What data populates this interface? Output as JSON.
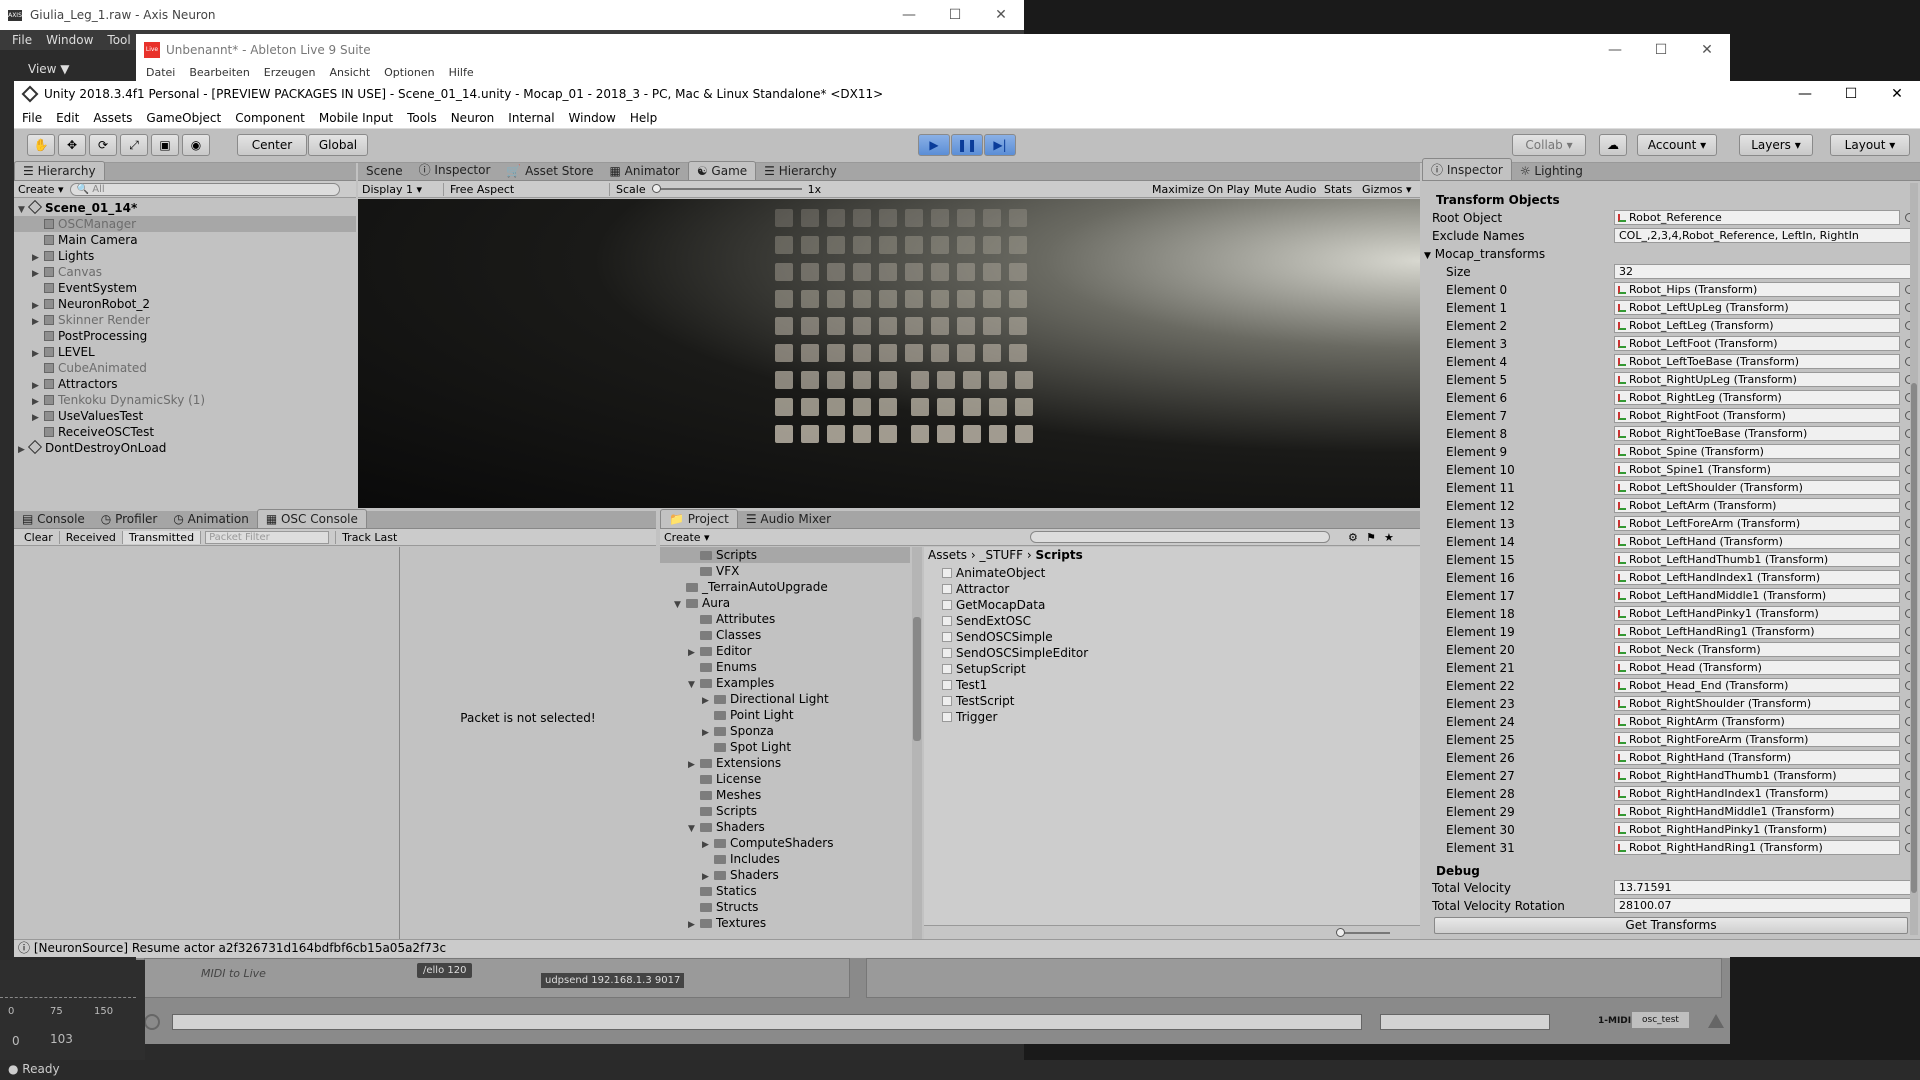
{
  "axis": {
    "title": "Giulia_Leg_1.raw - Axis Neuron",
    "menu": [
      "File",
      "Window",
      "Tool"
    ],
    "view_label": "View",
    "timeline": {
      "ticks": [
        "0",
        "75",
        "150"
      ],
      "start": "0",
      "end": "103"
    },
    "status": "Ready"
  },
  "ableton": {
    "title": "Unbenannt* - Ableton Live 9 Suite",
    "menu": [
      "Datei",
      "Bearbeiten",
      "Erzeugen",
      "Ansicht",
      "Optionen",
      "Hilfe"
    ],
    "clip1": "MIDI to Live",
    "clip2": "/ello 120",
    "clip3": "udpsend 192.168.1.3 9017",
    "track_label": "1-MIDI",
    "track_name": "osc_test"
  },
  "unity": {
    "title": "Unity 2018.3.4f1 Personal - [PREVIEW PACKAGES IN USE] - Scene_01_14.unity - Mocap_01 - 2018_3 - PC, Mac & Linux Standalone* <DX11>",
    "menu": [
      "File",
      "Edit",
      "Assets",
      "GameObject",
      "Component",
      "Mobile Input",
      "Tools",
      "Neuron",
      "Internal",
      "Window",
      "Help"
    ],
    "toolbar": {
      "center": "Center",
      "global": "Global",
      "collab": "Collab",
      "account": "Account",
      "layers": "Layers",
      "layout": "Layout"
    },
    "hierarchy": {
      "tab": "Hierarchy",
      "create": "Create",
      "search_placeholder": "All",
      "scene": "Scene_01_14*",
      "items": [
        {
          "name": "OSCManager",
          "arrow": "",
          "state": "selected"
        },
        {
          "name": "Main Camera",
          "arrow": "",
          "state": "normal"
        },
        {
          "name": "Lights",
          "arrow": "▶",
          "state": "normal"
        },
        {
          "name": "Canvas",
          "arrow": "▶",
          "state": "dim"
        },
        {
          "name": "EventSystem",
          "arrow": "",
          "state": "normal"
        },
        {
          "name": "NeuronRobot_2",
          "arrow": "▶",
          "state": "normal"
        },
        {
          "name": "Skinner Render",
          "arrow": "▶",
          "state": "dim"
        },
        {
          "name": "PostProcessing",
          "arrow": "",
          "state": "normal"
        },
        {
          "name": "LEVEL",
          "arrow": "▶",
          "state": "normal"
        },
        {
          "name": "CubeAnimated",
          "arrow": "",
          "state": "dim"
        },
        {
          "name": "Attractors",
          "arrow": "▶",
          "state": "normal"
        },
        {
          "name": "Tenkoku DynamicSky (1)",
          "arrow": "▶",
          "state": "dim"
        },
        {
          "name": "UseValuesTest",
          "arrow": "▶",
          "state": "normal"
        },
        {
          "name": "ReceiveOSCTest",
          "arrow": "",
          "state": "normal"
        }
      ],
      "dontdestroy": "DontDestroyOnLoad"
    },
    "center_tabs": [
      "Scene",
      "Inspector",
      "Asset Store",
      "Animator",
      "Game",
      "Hierarchy"
    ],
    "game_bar": {
      "display": "Display 1",
      "aspect": "Free Aspect",
      "scale": "Scale",
      "scale_val": "1x",
      "maximize": "Maximize On Play",
      "mute": "Mute Audio",
      "stats": "Stats",
      "gizmos": "Gizmos"
    },
    "bottom_tabs": [
      "Console",
      "Profiler",
      "Animation",
      "OSC Console"
    ],
    "osc": {
      "clear": "Clear",
      "received": "Received",
      "transmitted": "Transmitted",
      "filter_placeholder": "Packet Filter",
      "track": "Track Last",
      "message": "Packet is not selected!"
    },
    "project": {
      "tabs": [
        "Project",
        "Audio Mixer"
      ],
      "create": "Create",
      "breadcrumb": [
        "Assets",
        "_STUFF",
        "Scripts"
      ],
      "tree": [
        {
          "label": "Scripts",
          "indent": 2,
          "arrow": "",
          "sel": true
        },
        {
          "label": "VFX",
          "indent": 2,
          "arrow": ""
        },
        {
          "label": "_TerrainAutoUpgrade",
          "indent": 1,
          "arrow": ""
        },
        {
          "label": "Aura",
          "indent": 1,
          "arrow": "▼"
        },
        {
          "label": "Attributes",
          "indent": 2,
          "arrow": ""
        },
        {
          "label": "Classes",
          "indent": 2,
          "arrow": ""
        },
        {
          "label": "Editor",
          "indent": 2,
          "arrow": "▶"
        },
        {
          "label": "Enums",
          "indent": 2,
          "arrow": ""
        },
        {
          "label": "Examples",
          "indent": 2,
          "arrow": "▼"
        },
        {
          "label": "Directional Light",
          "indent": 3,
          "arrow": "▶"
        },
        {
          "label": "Point Light",
          "indent": 3,
          "arrow": ""
        },
        {
          "label": "Sponza",
          "indent": 3,
          "arrow": "▶"
        },
        {
          "label": "Spot Light",
          "indent": 3,
          "arrow": ""
        },
        {
          "label": "Extensions",
          "indent": 2,
          "arrow": "▶"
        },
        {
          "label": "License",
          "indent": 2,
          "arrow": ""
        },
        {
          "label": "Meshes",
          "indent": 2,
          "arrow": ""
        },
        {
          "label": "Scripts",
          "indent": 2,
          "arrow": ""
        },
        {
          "label": "Shaders",
          "indent": 2,
          "arrow": "▼"
        },
        {
          "label": "ComputeShaders",
          "indent": 3,
          "arrow": "▶"
        },
        {
          "label": "Includes",
          "indent": 3,
          "arrow": ""
        },
        {
          "label": "Shaders",
          "indent": 3,
          "arrow": "▶"
        },
        {
          "label": "Statics",
          "indent": 2,
          "arrow": ""
        },
        {
          "label": "Structs",
          "indent": 2,
          "arrow": ""
        },
        {
          "label": "Textures",
          "indent": 2,
          "arrow": "▶"
        }
      ],
      "files": [
        "AnimateObject",
        "Attractor",
        "GetMocapData",
        "SendExtOSC",
        "SendOSCSimple",
        "SendOSCSimpleEditor",
        "SetupScript",
        "Test1",
        "TestScript",
        "Trigger"
      ]
    },
    "inspector": {
      "tabs": [
        "Inspector",
        "Lighting"
      ],
      "header": "Transform Objects",
      "root_label": "Root Object",
      "root_value": "Robot_Reference",
      "exclude_label": "Exclude Names",
      "exclude_value": "COL_,2,3,4,Robot_Reference, LeftIn, RightIn",
      "mocap_label": "Mocap_transforms",
      "size_label": "Size",
      "size_value": "32",
      "elements": [
        {
          "label": "Element 0",
          "value": "Robot_Hips (Transform)"
        },
        {
          "label": "Element 1",
          "value": "Robot_LeftUpLeg (Transform)"
        },
        {
          "label": "Element 2",
          "value": "Robot_LeftLeg (Transform)"
        },
        {
          "label": "Element 3",
          "value": "Robot_LeftFoot (Transform)"
        },
        {
          "label": "Element 4",
          "value": "Robot_LeftToeBase (Transform)"
        },
        {
          "label": "Element 5",
          "value": "Robot_RightUpLeg (Transform)"
        },
        {
          "label": "Element 6",
          "value": "Robot_RightLeg (Transform)"
        },
        {
          "label": "Element 7",
          "value": "Robot_RightFoot (Transform)"
        },
        {
          "label": "Element 8",
          "value": "Robot_RightToeBase (Transform)"
        },
        {
          "label": "Element 9",
          "value": "Robot_Spine (Transform)"
        },
        {
          "label": "Element 10",
          "value": "Robot_Spine1 (Transform)"
        },
        {
          "label": "Element 11",
          "value": "Robot_LeftShoulder (Transform)"
        },
        {
          "label": "Element 12",
          "value": "Robot_LeftArm (Transform)"
        },
        {
          "label": "Element 13",
          "value": "Robot_LeftForeArm (Transform)"
        },
        {
          "label": "Element 14",
          "value": "Robot_LeftHand (Transform)"
        },
        {
          "label": "Element 15",
          "value": "Robot_LeftHandThumb1 (Transform)"
        },
        {
          "label": "Element 16",
          "value": "Robot_LeftHandIndex1 (Transform)"
        },
        {
          "label": "Element 17",
          "value": "Robot_LeftHandMiddle1 (Transform)"
        },
        {
          "label": "Element 18",
          "value": "Robot_LeftHandPinky1 (Transform)"
        },
        {
          "label": "Element 19",
          "value": "Robot_LeftHandRing1 (Transform)"
        },
        {
          "label": "Element 20",
          "value": "Robot_Neck (Transform)"
        },
        {
          "label": "Element 21",
          "value": "Robot_Head (Transform)"
        },
        {
          "label": "Element 22",
          "value": "Robot_Head_End (Transform)"
        },
        {
          "label": "Element 23",
          "value": "Robot_RightShoulder (Transform)"
        },
        {
          "label": "Element 24",
          "value": "Robot_RightArm (Transform)"
        },
        {
          "label": "Element 25",
          "value": "Robot_RightForeArm (Transform)"
        },
        {
          "label": "Element 26",
          "value": "Robot_RightHand (Transform)"
        },
        {
          "label": "Element 27",
          "value": "Robot_RightHandThumb1 (Transform)"
        },
        {
          "label": "Element 28",
          "value": "Robot_RightHandIndex1 (Transform)"
        },
        {
          "label": "Element 29",
          "value": "Robot_RightHandMiddle1 (Transform)"
        },
        {
          "label": "Element 30",
          "value": "Robot_RightHandPinky1 (Transform)"
        },
        {
          "label": "Element 31",
          "value": "Robot_RightHandRing1 (Transform)"
        }
      ],
      "debug": "Debug",
      "vel_label": "Total Velocity",
      "vel_value": "13.71591",
      "rot_label": "Total Velocity Rotation",
      "rot_value": "28100.07",
      "button": "Get Transforms"
    },
    "console_msg": "[NeuronSource] Resume actor a2f326731d164bdfbf6cb15a05a2f73c"
  },
  "colors": {
    "play_blue": "#5b8ed6",
    "selection": "#a7a7a7",
    "ableton_red": "#e8322b"
  }
}
